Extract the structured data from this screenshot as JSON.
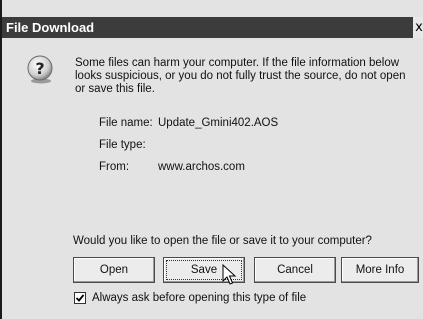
{
  "dialog": {
    "title": "File Download",
    "close_label": "x",
    "warning_text": "Some files can harm your computer. If the file information below looks suspicious, or you do not fully trust the source, do not open or save this file.",
    "file_info": {
      "name_label": "File name:",
      "name_value": "Update_Gmini402.AOS",
      "type_label": "File type:",
      "type_value": "",
      "from_label": "From:",
      "from_value": "www.archos.com"
    },
    "question": "Would you like to open the file or save it to your computer?",
    "buttons": {
      "open": "Open",
      "save": "Save",
      "cancel": "Cancel",
      "more_info": "More Info"
    },
    "always_ask": {
      "label": "Always ask before opening this type of file",
      "checked": true
    }
  },
  "colors": {
    "title_bar": "#3c3c3c",
    "dialog_bg": "#e3e3e3"
  },
  "icons": [
    "question-icon",
    "checkmark-icon",
    "mouse-cursor-icon"
  ]
}
